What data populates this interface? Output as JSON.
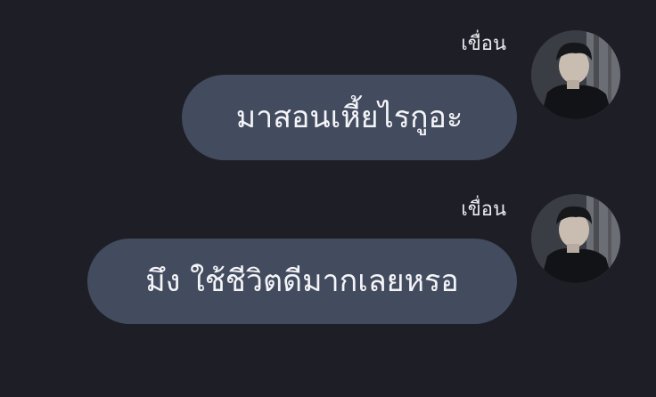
{
  "chat": {
    "messages": [
      {
        "sender": "เขื่อน",
        "text": "มาสอนเหี้ยไรกูอะ",
        "avatar_icon": "user-avatar-icon"
      },
      {
        "sender": "เขื่อน",
        "text": "มึง ใช้ชีวิตดีมากเลยหรอ",
        "avatar_icon": "user-avatar-icon"
      }
    ]
  },
  "colors": {
    "background": "#1e1f26",
    "bubble": "#434b5e",
    "text": "#f4f5f8"
  }
}
